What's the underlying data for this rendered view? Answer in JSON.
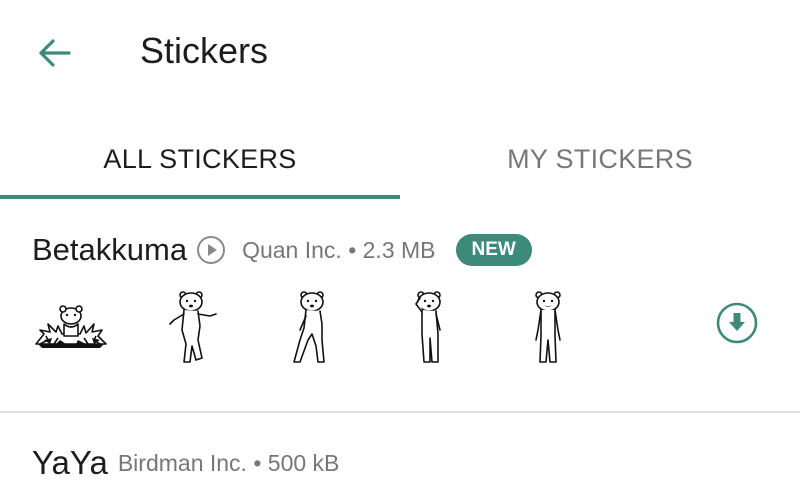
{
  "appbar": {
    "title": "Stickers",
    "back_icon": "arrow-left-icon"
  },
  "tabs": [
    {
      "label": "ALL STICKERS",
      "selected": true
    },
    {
      "label": "MY STICKERS",
      "selected": false
    }
  ],
  "colors": {
    "accent": "#3e8a7a",
    "text_primary": "#1d1d1d",
    "text_secondary": "#777777",
    "divider": "#e0e0e0"
  },
  "packs": [
    {
      "name": "Betakkuma",
      "meta": "Quan Inc. • 2.3 MB",
      "badge": "NEW",
      "play_icon": "play-circle-icon",
      "download_icon": "download-circle-icon",
      "stickers": [
        "bear-sticker-explosion",
        "bear-sticker-dancing",
        "bear-sticker-walking",
        "bear-sticker-saluting",
        "bear-sticker-standing"
      ]
    },
    {
      "name": "YaYa",
      "meta": "Birdman Inc. • 500 kB"
    }
  ]
}
